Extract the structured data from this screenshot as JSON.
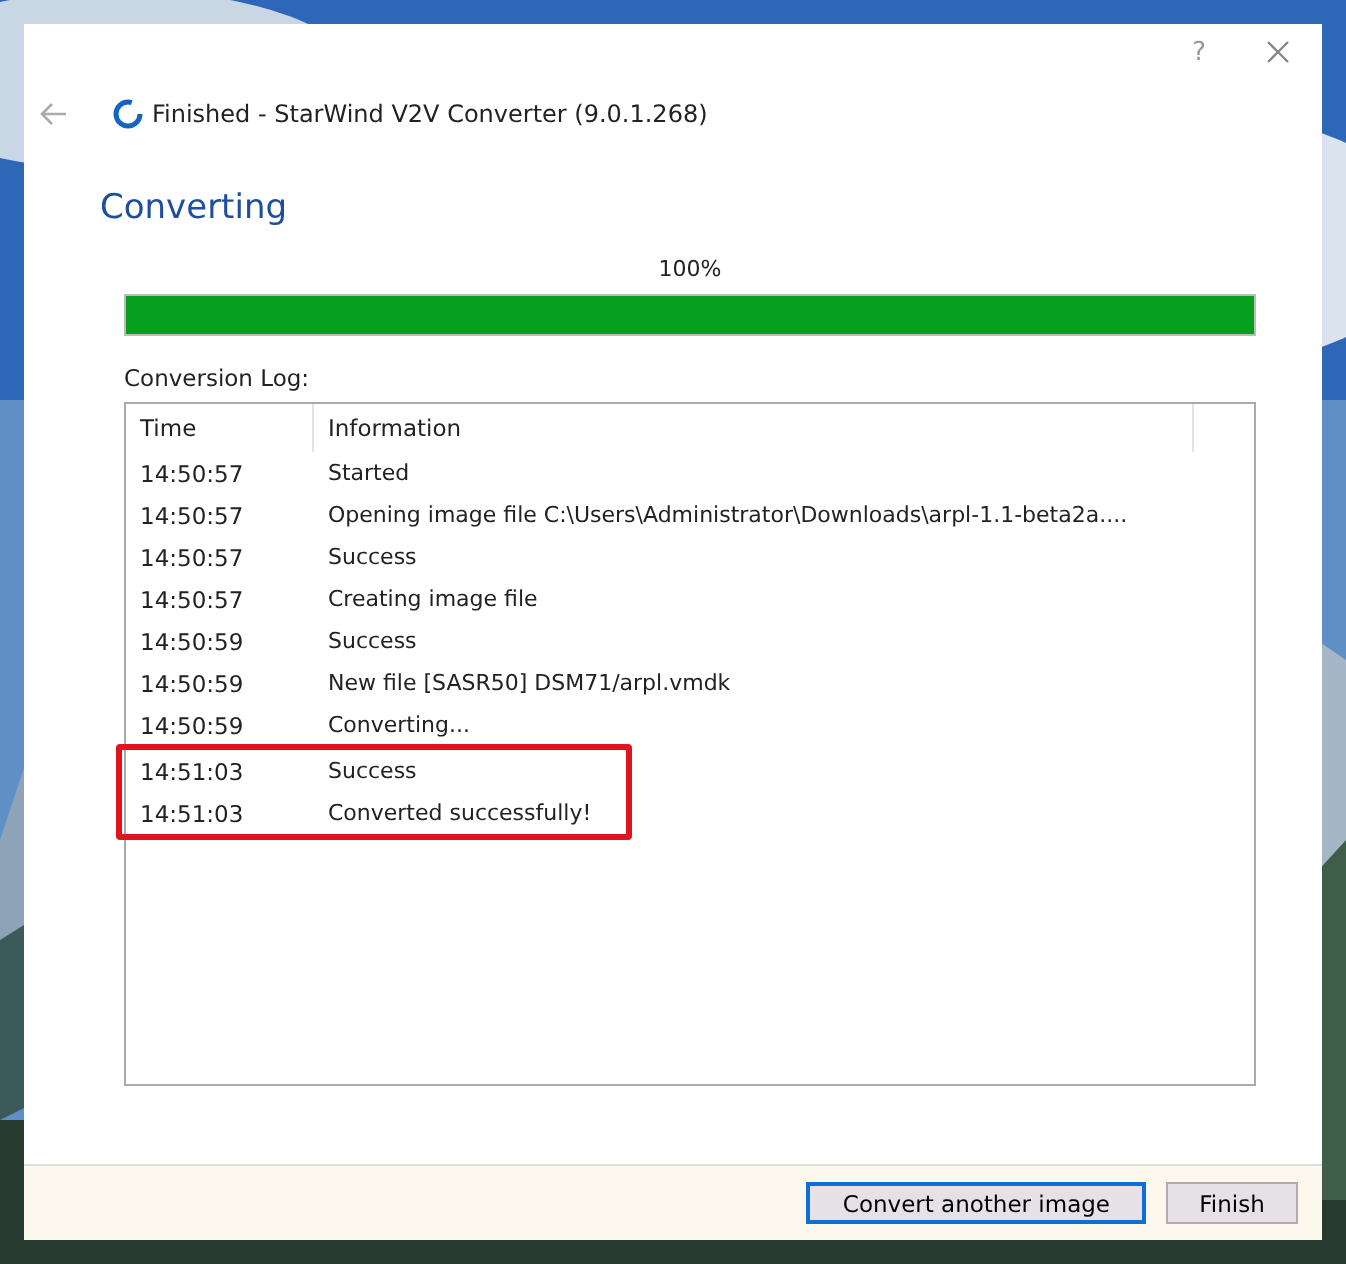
{
  "window": {
    "title": "Finished - StarWind V2V Converter (9.0.1.268)",
    "help": "?"
  },
  "heading": "Converting",
  "progress": {
    "reading": "100%",
    "level": 1
  },
  "log": {
    "label": "Conversion Log:",
    "columns": [
      "Time",
      "Information"
    ],
    "rows": [
      {
        "time": "14:50:57",
        "info": "Started",
        "highlighted": false
      },
      {
        "time": "14:50:57",
        "info": "Opening image file C:\\Users\\Administrator\\Downloads\\arpl-1.1-beta2a....",
        "highlighted": false
      },
      {
        "time": "14:50:57",
        "info": "Success",
        "highlighted": false
      },
      {
        "time": "14:50:57",
        "info": "Creating image file",
        "highlighted": false
      },
      {
        "time": "14:50:59",
        "info": "Success",
        "highlighted": false
      },
      {
        "time": "14:50:59",
        "info": "New file [SASR50] DSM71/arpl.vmdk",
        "highlighted": false
      },
      {
        "time": "14:50:59",
        "info": "Converting...",
        "highlighted": false
      },
      {
        "time": "14:51:03",
        "info": "Success",
        "highlighted": true
      },
      {
        "time": "14:51:03",
        "info": "Converted successfully!",
        "highlighted": true
      }
    ]
  },
  "buttons": [
    {
      "label": "Convert another image",
      "default": true
    },
    {
      "label": "Finish",
      "default": false
    }
  ]
}
